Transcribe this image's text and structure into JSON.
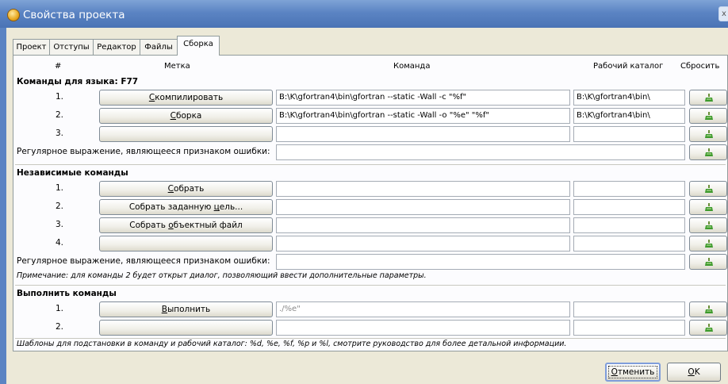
{
  "window": {
    "title": "Свойства проекта",
    "close_glyph": "x"
  },
  "tabs": [
    {
      "label": "Проект"
    },
    {
      "label": "Отступы"
    },
    {
      "label": "Редактор"
    },
    {
      "label": "Файлы"
    },
    {
      "label": "Сборка",
      "active": true
    }
  ],
  "columns": {
    "num": "#",
    "label": "Метка",
    "command": "Команда",
    "workdir": "Рабочий каталог",
    "reset": "Сбросить"
  },
  "language_section": {
    "title": "Команды для языка: F77",
    "rows": [
      {
        "num": "1.",
        "btn_pre": "",
        "btn_ul": "С",
        "btn_post": "компилировать",
        "command": "B:\\K\\gfortran4\\bin\\gfortran  --static -Wall -c \"%f\"",
        "workdir": "B:\\K\\gfortran4\\bin\\"
      },
      {
        "num": "2.",
        "btn_pre": "",
        "btn_ul": "С",
        "btn_post": "борка",
        "command": "B:\\K\\gfortran4\\bin\\gfortran  --static -Wall -o \"%e\" \"%f\"",
        "workdir": "B:\\K\\gfortran4\\bin\\"
      },
      {
        "num": "3.",
        "btn_pre": "",
        "btn_ul": "",
        "btn_post": "",
        "command": "",
        "workdir": ""
      }
    ],
    "regex_label": "Регулярное выражение, являющееся признаком ошибки:",
    "regex_value": ""
  },
  "independent_section": {
    "title": "Независимые команды",
    "rows": [
      {
        "num": "1.",
        "btn_pre": "",
        "btn_ul": "С",
        "btn_post": "обрать",
        "command": "",
        "workdir": ""
      },
      {
        "num": "2.",
        "btn_pre": "Собрать заданную ",
        "btn_ul": "ц",
        "btn_post": "ель...",
        "command": "",
        "workdir": ""
      },
      {
        "num": "3.",
        "btn_pre": "Собрать ",
        "btn_ul": "о",
        "btn_post": "бъектный файл",
        "command": "",
        "workdir": ""
      },
      {
        "num": "4.",
        "btn_pre": "",
        "btn_ul": "",
        "btn_post": "",
        "command": "",
        "workdir": ""
      }
    ],
    "regex_label": "Регулярное выражение, являющееся признаком ошибки:",
    "regex_value": "",
    "note": "Примечание: для команды 2 будет открыт диалог, позволяющий ввести дополнительные параметры."
  },
  "execute_section": {
    "title": "Выполнить команды",
    "rows": [
      {
        "num": "1.",
        "btn_pre": "",
        "btn_ul": "В",
        "btn_post": "ыполнить",
        "command_placeholder": "./%e\"",
        "workdir": ""
      },
      {
        "num": "2.",
        "btn_pre": "",
        "btn_ul": "",
        "btn_post": "",
        "command": "",
        "workdir": ""
      }
    ]
  },
  "footer_note": "Шаблоны для подстановки в команду и рабочий каталог: %d, %e, %f, %p и %l, смотрите руководство для более детальной информации.",
  "buttons": {
    "cancel_ul": "О",
    "cancel_post": "тменить",
    "ok_ul": "O",
    "ok_post": "K"
  },
  "icons": {
    "reset": "broom-icon",
    "app": "geany-icon",
    "close": "close-icon"
  },
  "colors": {
    "titlebar": "#5b84c3",
    "dialog_bg": "#ece9d8",
    "panel_bg": "#fcfcfe",
    "reset_icon": "#3d9a2c"
  }
}
